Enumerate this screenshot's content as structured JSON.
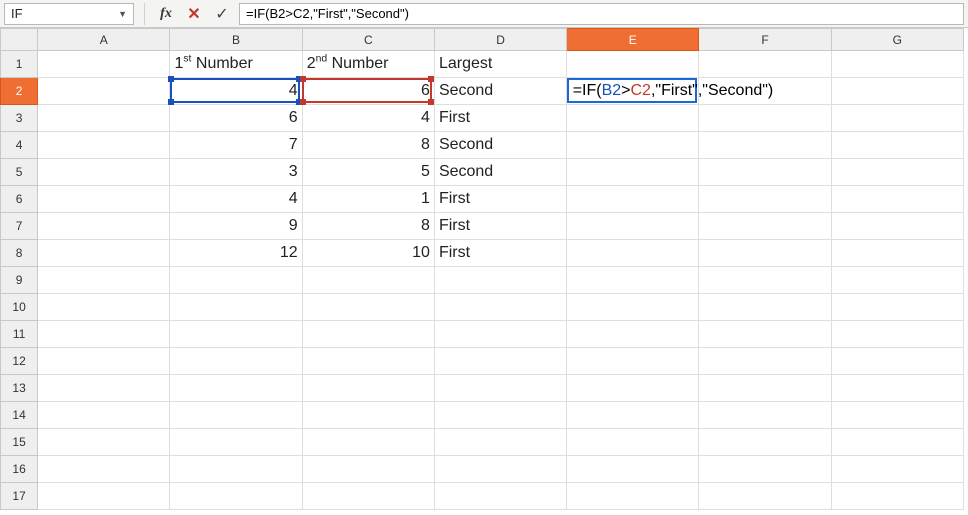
{
  "formula_bar": {
    "name_box": "IF",
    "fx_label": "fx",
    "cancel_glyph": "✕",
    "accept_glyph": "✓",
    "sep_glyph": "|",
    "formula_text": "=IF(B2>C2,\"First\",\"Second\")"
  },
  "columns": [
    "A",
    "B",
    "C",
    "D",
    "E",
    "F",
    "G"
  ],
  "header_row": {
    "B": {
      "ord": "1",
      "sup": "st",
      "label": " Number"
    },
    "C": {
      "ord": "2",
      "sup": "nd",
      "label": " Number"
    },
    "D": "Largest"
  },
  "data_rows": [
    {
      "r": 2,
      "B": "4",
      "C": "6",
      "D": "Second"
    },
    {
      "r": 3,
      "B": "6",
      "C": "4",
      "D": "First"
    },
    {
      "r": 4,
      "B": "7",
      "C": "8",
      "D": "Second"
    },
    {
      "r": 5,
      "B": "3",
      "C": "5",
      "D": "Second"
    },
    {
      "r": 6,
      "B": "4",
      "C": "1",
      "D": "First"
    },
    {
      "r": 7,
      "B": "9",
      "C": "8",
      "D": "First"
    },
    {
      "r": 8,
      "B": "12",
      "C": "10",
      "D": "First"
    }
  ],
  "total_rows": 17,
  "active_cell": "E2",
  "active_col": "E",
  "active_row": 2,
  "ref_highlights": {
    "blue": "B2",
    "red": "C2"
  },
  "e2_formula_parts": {
    "p1": "=IF(",
    "p2": "B2",
    "p3": ">",
    "p4": "C2",
    "p5": ",\"First\",\"Second\")"
  },
  "colors": {
    "accent": "#ef6e33",
    "ref_blue": "#1a4fc0",
    "ref_red": "#c0392b"
  }
}
